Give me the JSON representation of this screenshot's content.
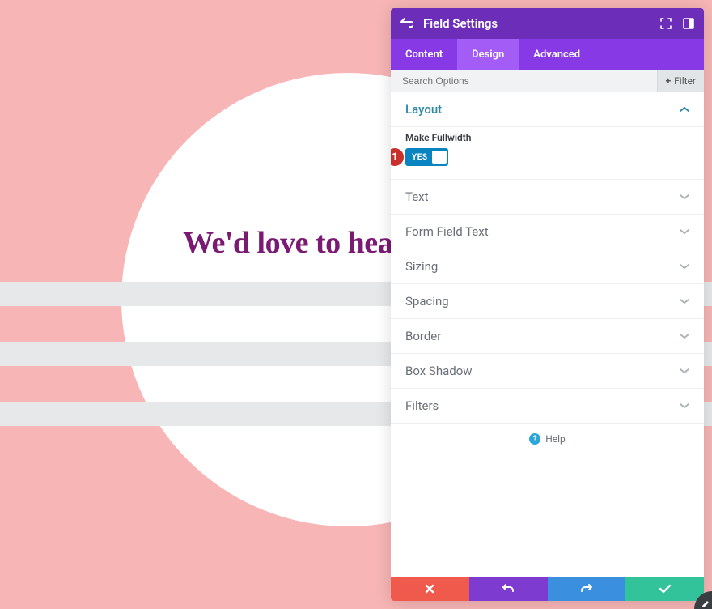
{
  "background": {
    "heading_text": "We'd love to hear from you"
  },
  "panel": {
    "title": "Field Settings",
    "tabs": {
      "content": "Content",
      "design": "Design",
      "advanced": "Advanced"
    },
    "search_placeholder": "Search Options",
    "filter_label": "Filter"
  },
  "layout": {
    "section_label": "Layout",
    "fullwidth_label": "Make Fullwidth",
    "fullwidth_toggle_text": "YES",
    "marker_number": "1"
  },
  "sections": {
    "text": "Text",
    "form_field_text": "Form Field Text",
    "sizing": "Sizing",
    "spacing": "Spacing",
    "border": "Border",
    "box_shadow": "Box Shadow",
    "filters": "Filters"
  },
  "help_label": "Help"
}
